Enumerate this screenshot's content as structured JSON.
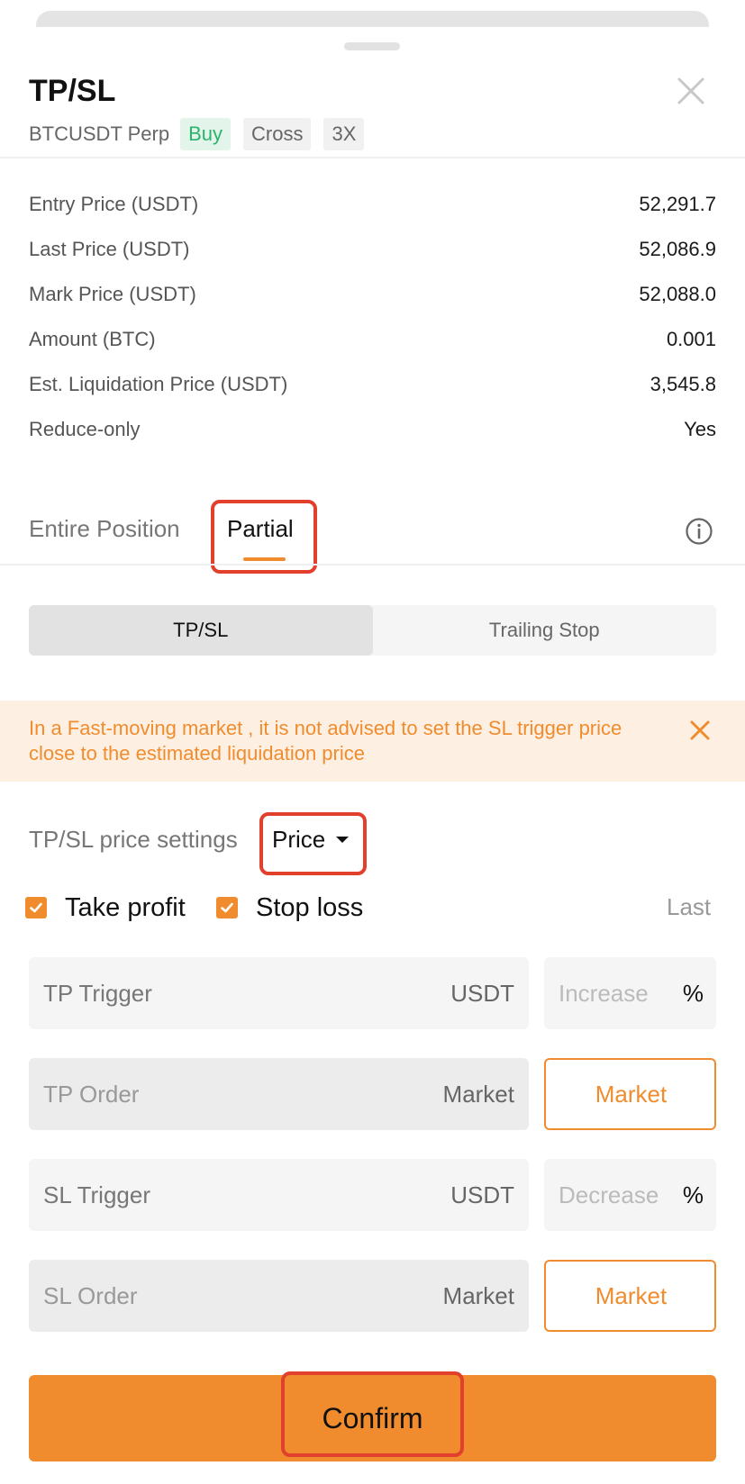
{
  "sheet": {
    "title": "TP/SL",
    "symbol": "BTCUSDT Perp",
    "tags": [
      "Buy",
      "Cross",
      "3X"
    ]
  },
  "info": [
    {
      "label": "Entry Price (USDT)",
      "value": "52,291.7"
    },
    {
      "label": "Last Price (USDT)",
      "value": "52,086.9"
    },
    {
      "label": "Mark Price (USDT)",
      "value": "52,088.0"
    },
    {
      "label": "Amount (BTC)",
      "value": "0.001"
    },
    {
      "label": "Est. Liquidation Price (USDT)",
      "value": "3,545.8"
    },
    {
      "label": "Reduce-only",
      "value": "Yes"
    }
  ],
  "tabs": {
    "entire": "Entire Position",
    "partial": "Partial",
    "active": "partial"
  },
  "mode": {
    "tpsl": "TP/SL",
    "trailing": "Trailing Stop",
    "active": "tpsl"
  },
  "warning": {
    "text": "In a Fast-moving market , it is not advised to set the SL trigger price close to the estimated liquidation price"
  },
  "settings": {
    "label": "TP/SL price settings",
    "selected": "Price",
    "take_profit": "Take profit",
    "stop_loss": "Stop loss",
    "take_profit_checked": true,
    "stop_loss_checked": true,
    "trigger_source": "Last"
  },
  "fields": {
    "tp_trigger": {
      "placeholder": "TP Trigger",
      "unit": "USDT",
      "side_placeholder": "Increase",
      "side_unit": "%"
    },
    "tp_order": {
      "placeholder": "TP Order",
      "unit": "Market",
      "button": "Market"
    },
    "sl_trigger": {
      "placeholder": "SL Trigger",
      "unit": "USDT",
      "side_placeholder": "Decrease",
      "side_unit": "%"
    },
    "sl_order": {
      "placeholder": "SL Order",
      "unit": "Market",
      "button": "Market"
    }
  },
  "confirm_label": "Confirm",
  "colors": {
    "accent": "#f08c2e",
    "buy": "#2cb36b",
    "highlight": "#e0402c"
  }
}
